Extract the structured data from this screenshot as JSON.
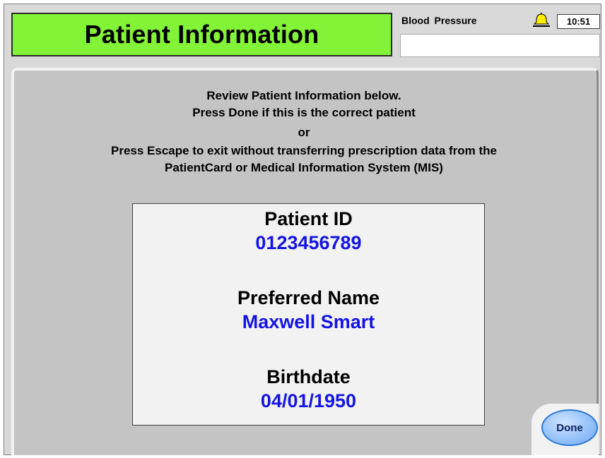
{
  "header": {
    "title": "Patient Information",
    "parameter_label": "Blood Pressure",
    "parameter_value": "",
    "clock": "10:51",
    "alarm_icon": "bell-icon",
    "title_color": "#83f337"
  },
  "instructions": {
    "line1": "Review Patient Information below.",
    "line2": "Press Done if this is the correct patient",
    "line3": "or",
    "line4": "Press Escape to exit without transferring prescription data from the",
    "line5": "PatientCard or Medical Information System (MIS)"
  },
  "patient": {
    "id_label": "Patient ID",
    "id_value": "0123456789",
    "name_label": "Preferred Name",
    "name_value": "Maxwell Smart",
    "birthdate_label": "Birthdate",
    "birthdate_value": "04/01/1950",
    "value_color": "#1414e6"
  },
  "actions": {
    "done_label": "Done"
  }
}
